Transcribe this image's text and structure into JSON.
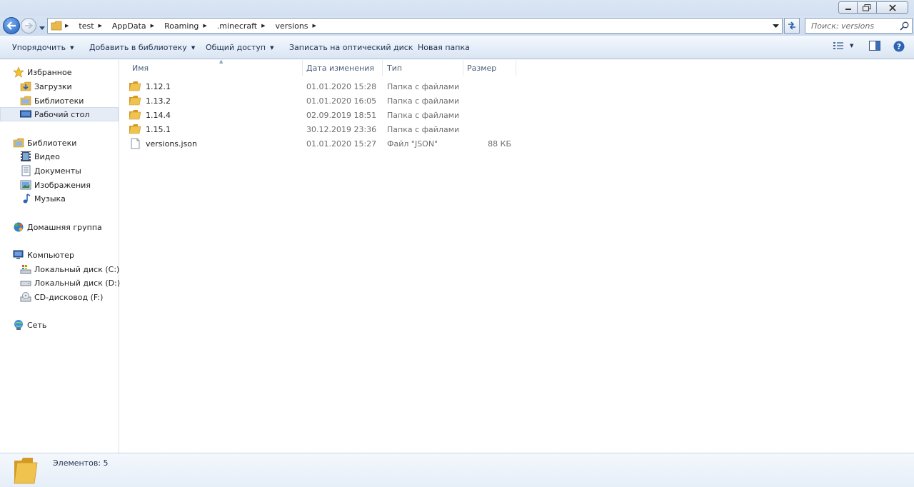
{
  "window": {
    "minimize_glyph": "–",
    "maximize_glyph": "□",
    "close_glyph": "✕"
  },
  "address": {
    "segments": [
      "test",
      "AppData",
      "Roaming",
      ".minecraft",
      "versions"
    ]
  },
  "search": {
    "placeholder": "Поиск: versions"
  },
  "toolbar": {
    "organize": "Упорядочить",
    "add_to_library": "Добавить в библиотеку",
    "share": "Общий доступ",
    "burn": "Записать на оптический диск",
    "new_folder": "Новая папка"
  },
  "sidebar": {
    "favorites": {
      "label": "Избранное",
      "items": [
        "Загрузки",
        "Библиотеки",
        "Рабочий стол"
      ]
    },
    "libraries": {
      "label": "Библиотеки",
      "items": [
        "Видео",
        "Документы",
        "Изображения",
        "Музыка"
      ]
    },
    "homegroup": {
      "label": "Домашняя группа"
    },
    "computer": {
      "label": "Компьютер",
      "items": [
        "Локальный диск (C:)",
        "Локальный диск (D:)",
        "CD-дисковод (F:)"
      ]
    },
    "network": {
      "label": "Сеть"
    }
  },
  "columns": {
    "name": "Имя",
    "date": "Дата изменения",
    "type": "Тип",
    "size": "Размер"
  },
  "files": [
    {
      "name": "1.12.1",
      "date": "01.01.2020 15:28",
      "type": "Папка с файлами",
      "size": "",
      "icon": "folder-icon"
    },
    {
      "name": "1.13.2",
      "date": "01.01.2020 16:05",
      "type": "Папка с файлами",
      "size": "",
      "icon": "folder-icon"
    },
    {
      "name": "1.14.4",
      "date": "02.09.2019 18:51",
      "type": "Папка с файлами",
      "size": "",
      "icon": "folder-icon"
    },
    {
      "name": "1.15.1",
      "date": "30.12.2019 23:36",
      "type": "Папка с файлами",
      "size": "",
      "icon": "folder-icon"
    },
    {
      "name": "versions.json",
      "date": "01.01.2020 15:27",
      "type": "Файл \"JSON\"",
      "size": "88 КБ",
      "icon": "file-icon"
    }
  ],
  "status": {
    "items_count": "Элементов: 5"
  },
  "colors": {
    "folder": "#e8b84a",
    "accent": "#1f5fbf"
  }
}
